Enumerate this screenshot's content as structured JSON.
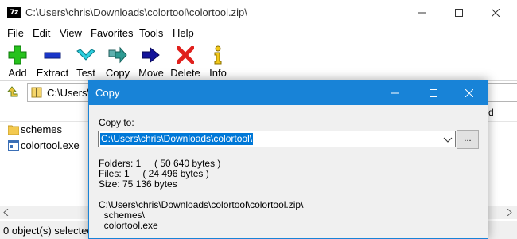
{
  "main": {
    "app_icon_text": "7z",
    "title": "C:\\Users\\chris\\Downloads\\colortool\\colortool.zip\\",
    "menu": [
      "File",
      "Edit",
      "View",
      "Favorites",
      "Tools",
      "Help"
    ],
    "toolbar": [
      {
        "label": "Add",
        "icon": "plus-icon"
      },
      {
        "label": "Extract",
        "icon": "minus-icon"
      },
      {
        "label": "Test",
        "icon": "check-icon"
      },
      {
        "label": "Copy",
        "icon": "copy-arrow-icon"
      },
      {
        "label": "Move",
        "icon": "move-arrow-icon"
      },
      {
        "label": "Delete",
        "icon": "x-icon"
      },
      {
        "label": "Info",
        "icon": "info-icon"
      }
    ],
    "address": "C:\\Users\\c",
    "column_header_right": "d",
    "files": [
      {
        "name": "schemes",
        "icon": "folder-icon"
      },
      {
        "name": "colortool.exe",
        "icon": "exe-icon"
      }
    ],
    "status": "0 object(s) selected"
  },
  "dialog": {
    "title": "Copy",
    "copy_to_label": "Copy to:",
    "path_value": "C:\\Users\\chris\\Downloads\\colortool\\",
    "browse_label": "...",
    "folders_line": "Folders: 1     ( 50 640 bytes )",
    "files_line": "Files: 1     ( 24 496 bytes )",
    "size_line": "Size: 75 136 bytes",
    "archive_path": "C:\\Users\\chris\\Downloads\\colortool\\colortool.zip\\",
    "item1": "  schemes\\",
    "item2": "  colortool.exe"
  },
  "colors": {
    "dialog_accent": "#1883d7",
    "selection": "#0078d7"
  }
}
